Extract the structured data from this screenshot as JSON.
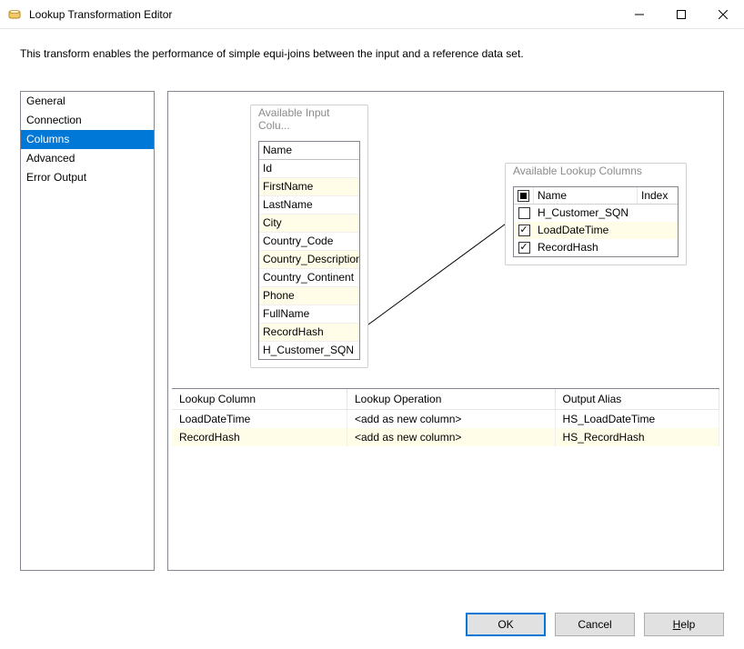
{
  "window": {
    "title": "Lookup Transformation Editor"
  },
  "description": "This transform enables the performance of simple equi-joins between the input and a reference data set.",
  "sidebar": {
    "items": [
      {
        "label": "General",
        "selected": false
      },
      {
        "label": "Connection",
        "selected": false
      },
      {
        "label": "Columns",
        "selected": true
      },
      {
        "label": "Advanced",
        "selected": false
      },
      {
        "label": "Error Output",
        "selected": false
      }
    ]
  },
  "input_columns": {
    "title": "Available Input Colu...",
    "header": "Name",
    "rows": [
      {
        "name": "Id",
        "alt": false
      },
      {
        "name": "FirstName",
        "alt": true
      },
      {
        "name": "LastName",
        "alt": false
      },
      {
        "name": "City",
        "alt": true
      },
      {
        "name": "Country_Code",
        "alt": false
      },
      {
        "name": "Country_Description",
        "alt": true
      },
      {
        "name": "Country_Continent",
        "alt": false
      },
      {
        "name": "Phone",
        "alt": true
      },
      {
        "name": "FullName",
        "alt": false
      },
      {
        "name": "RecordHash",
        "alt": true
      },
      {
        "name": "H_Customer_SQN",
        "alt": false
      }
    ]
  },
  "lookup_columns": {
    "title": "Available Lookup Columns",
    "headers": {
      "name": "Name",
      "index": "Index"
    },
    "rows": [
      {
        "name": "H_Customer_SQN",
        "checked": false,
        "alt": false
      },
      {
        "name": "LoadDateTime",
        "checked": true,
        "alt": true
      },
      {
        "name": "RecordHash",
        "checked": true,
        "alt": false
      }
    ]
  },
  "mapping": {
    "headers": {
      "col": "Lookup Column",
      "op": "Lookup Operation",
      "alias": "Output Alias"
    },
    "rows": [
      {
        "col": "LoadDateTime",
        "op": "<add as new column>",
        "alias": "HS_LoadDateTime",
        "alt": false
      },
      {
        "col": "RecordHash",
        "op": "<add as new column>",
        "alias": "HS_RecordHash",
        "alt": true
      }
    ]
  },
  "buttons": {
    "ok": "OK",
    "cancel": "Cancel",
    "help": "Help"
  }
}
